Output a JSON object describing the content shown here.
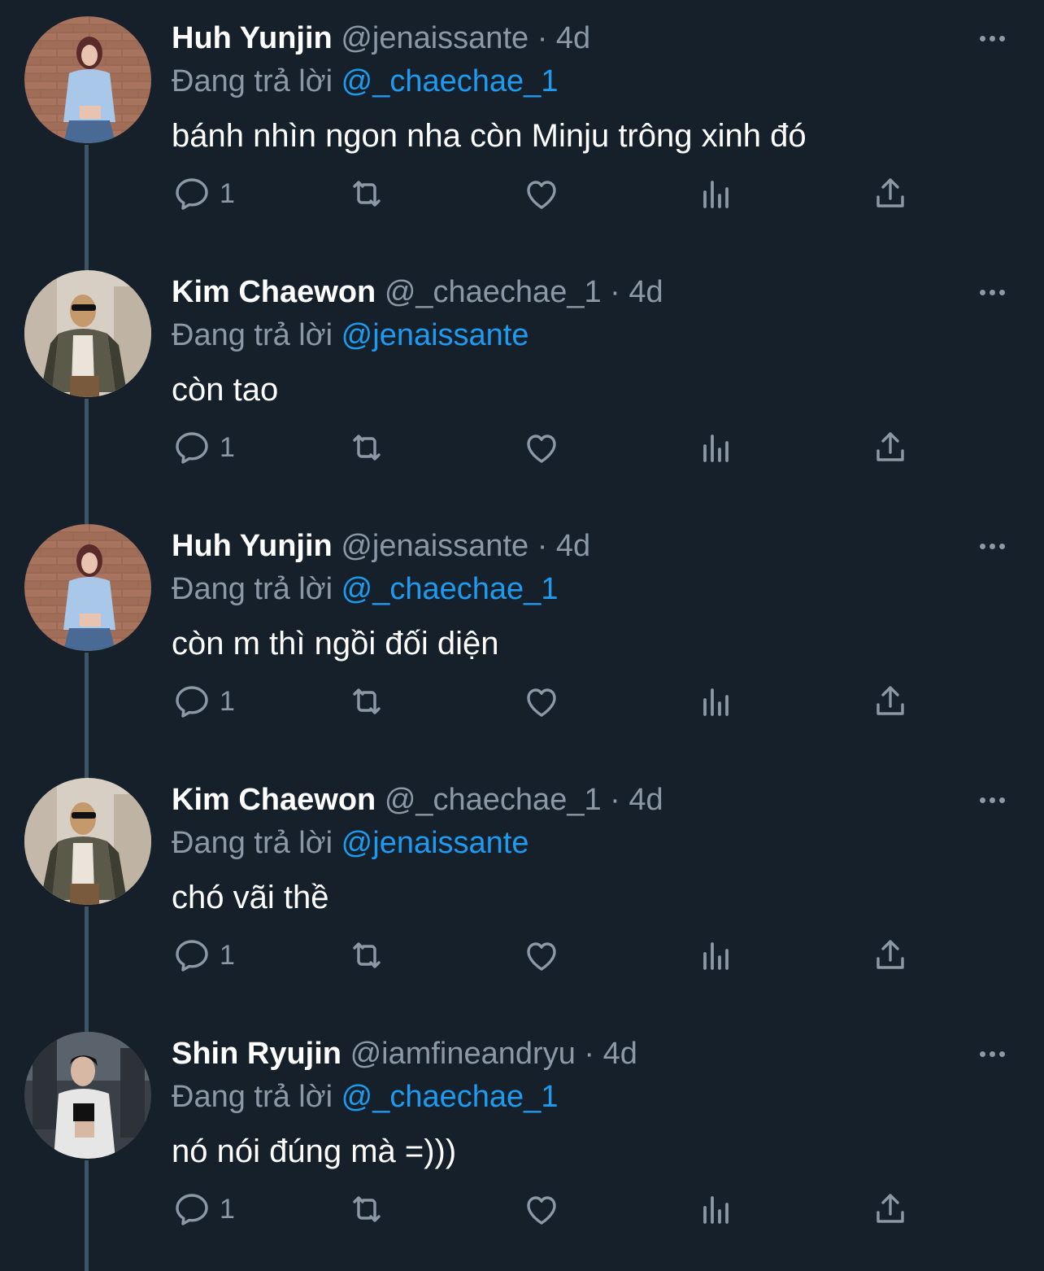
{
  "colors": {
    "background": "#15202b",
    "text_primary": "#ffffff",
    "text_secondary": "#8b98a5",
    "mention": "#1d9bf0",
    "thread_line": "#3d5466"
  },
  "reply_prefix": "Đang trả lời",
  "tweets": [
    {
      "name": "Huh Yunjin",
      "handle": "@jenaissante",
      "separator": "·",
      "time": "4d",
      "reply_to": "@_chaechae_1",
      "text": "bánh nhìn ngon nha còn Minju trông xinh đó",
      "reply_count": "1"
    },
    {
      "name": "Kim Chaewon",
      "handle": "@_chaechae_1",
      "separator": "·",
      "time": "4d",
      "reply_to": "@jenaissante",
      "text": "còn tao",
      "reply_count": "1"
    },
    {
      "name": "Huh Yunjin",
      "handle": "@jenaissante",
      "separator": "·",
      "time": "4d",
      "reply_to": "@_chaechae_1",
      "text": "còn m thì ngồi đối diện",
      "reply_count": "1"
    },
    {
      "name": "Kim Chaewon",
      "handle": "@_chaechae_1",
      "separator": "·",
      "time": "4d",
      "reply_to": "@jenaissante",
      "text": "chó vãi thề",
      "reply_count": "1"
    },
    {
      "name": "Shin Ryujin",
      "handle": "@iamfineandryu",
      "separator": "·",
      "time": "4d",
      "reply_to": "@_chaechae_1",
      "text": "nó nói đúng mà =)))",
      "reply_count": "1"
    }
  ],
  "icons": {
    "more": "more-horizontal-icon",
    "reply": "reply-bubble-icon",
    "retweet": "retweet-icon",
    "like": "heart-icon",
    "analytics": "analytics-bars-icon",
    "share": "share-upload-icon"
  }
}
